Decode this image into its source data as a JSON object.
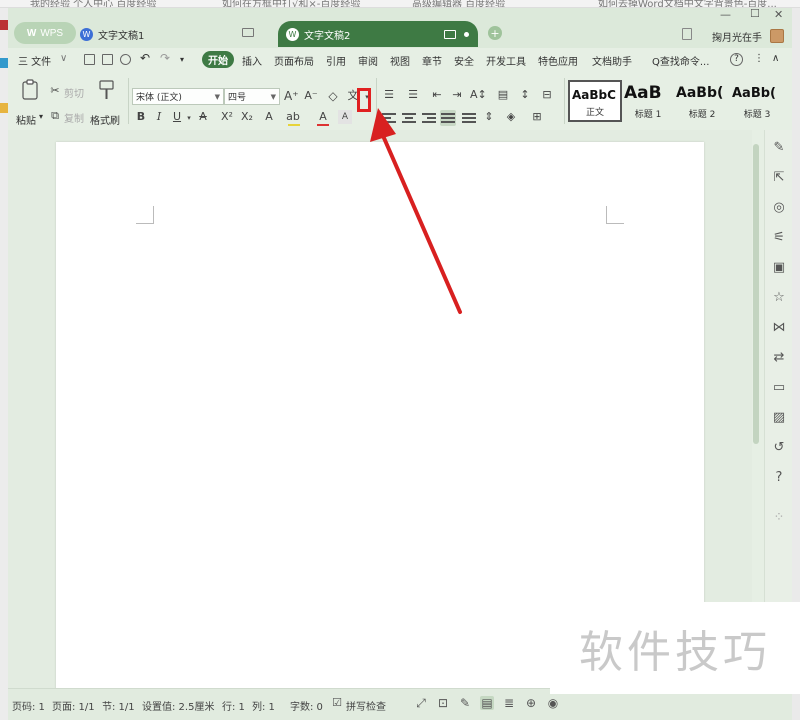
{
  "browser_strip": {
    "tab_texts": [
      "我的经验 个人中心 百度经验",
      "如何在方框中打√和×-百度经验",
      "高级编辑器 百度经验",
      "如何去掉Word文档中文字背景色-百度..."
    ]
  },
  "titlebar": {
    "app_button": "WPS",
    "tab1_title": "文字文稿1",
    "tab2_title": "文字文稿2",
    "user_name": "掬月光在手",
    "controls": {
      "minimize": "—",
      "maximize": "☐",
      "close": "✕"
    }
  },
  "menubar": {
    "file": "三 文件",
    "file_caret": "∨",
    "tabs": [
      "开始",
      "插入",
      "页面布局",
      "引用",
      "审阅",
      "视图",
      "章节",
      "安全",
      "开发工具",
      "特色应用",
      "文档助手"
    ],
    "search_command": "Q查找命令...",
    "help_icon": "?",
    "more_icon": "⋮",
    "collapse_icon": "∧"
  },
  "ribbon": {
    "paste": "粘贴",
    "paste_caret": "▾",
    "cut": "剪切",
    "copy": "复制",
    "format_painter": "格式刷",
    "font_name": "宋体 (正文)",
    "font_size": "四号",
    "styles": [
      {
        "sample": "AaBbC",
        "label": "正文"
      },
      {
        "sample": "AaB",
        "label": "标题 1"
      },
      {
        "sample": "AaBb(",
        "label": "标题 2"
      },
      {
        "sample": "AaBb(",
        "label": "标题 3"
      }
    ]
  },
  "statusbar": {
    "page_no": "页码: 1",
    "pages": "页面: 1/1",
    "section": "节: 1/1",
    "setting": "设置值: 2.5厘米",
    "row": "行: 1",
    "col": "列: 1",
    "words": "字数: 0",
    "spellcheck": "拼写检查"
  },
  "watermark": {
    "text": "软件技巧"
  },
  "colors": {
    "accent_green": "#3e7a44",
    "highlight_red": "#e02020",
    "arrow_red": "#d82020"
  }
}
